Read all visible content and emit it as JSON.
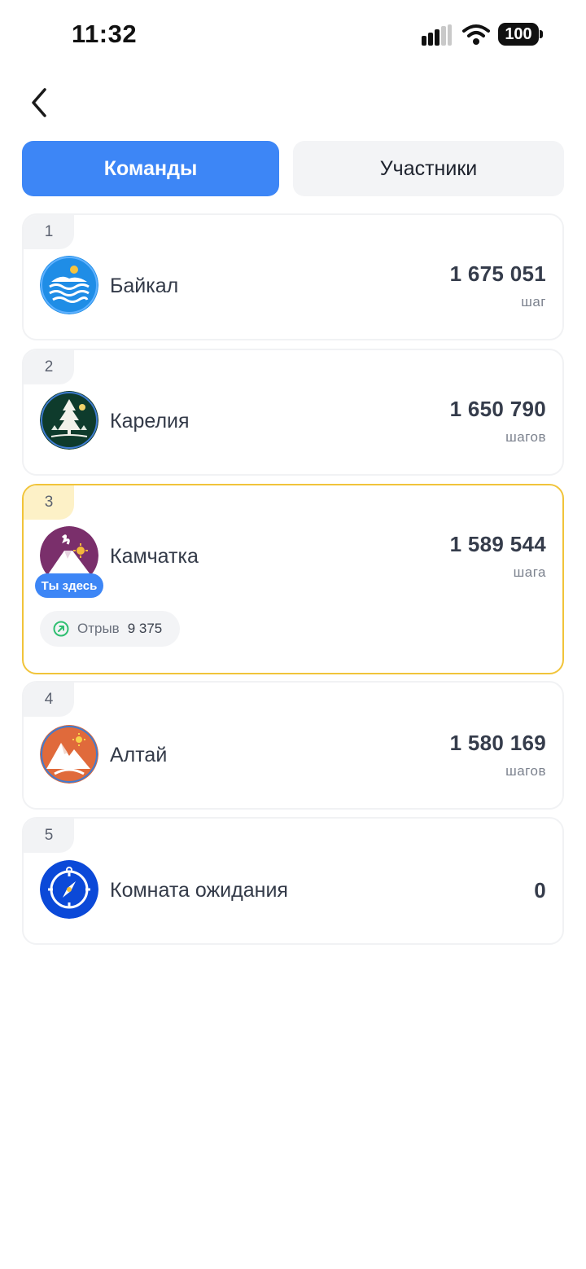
{
  "status_bar": {
    "time": "11:32",
    "battery": "100"
  },
  "tabs": [
    {
      "label": "Команды",
      "active": true
    },
    {
      "label": "Участники",
      "active": false
    }
  ],
  "teams": [
    {
      "rank": "1",
      "name": "Байкал",
      "steps": "1 675 051",
      "unit": "шаг",
      "icon": "lake-icon"
    },
    {
      "rank": "2",
      "name": "Карелия",
      "steps": "1 650 790",
      "unit": "шагов",
      "icon": "forest-icon"
    },
    {
      "rank": "3",
      "name": "Камчатка",
      "steps": "1 589 544",
      "unit": "шага",
      "icon": "volcano-icon",
      "you_here": "Ты здесь",
      "gap_label": "Отрыв",
      "gap_value": "9 375"
    },
    {
      "rank": "4",
      "name": "Алтай",
      "steps": "1 580 169",
      "unit": "шагов",
      "icon": "mountains-icon"
    },
    {
      "rank": "5",
      "name": "Комната ожидания",
      "steps": "0",
      "unit": "",
      "icon": "compass-icon"
    }
  ],
  "colors": {
    "accent": "#3d86f6",
    "highlight_border": "#f1c43a"
  }
}
